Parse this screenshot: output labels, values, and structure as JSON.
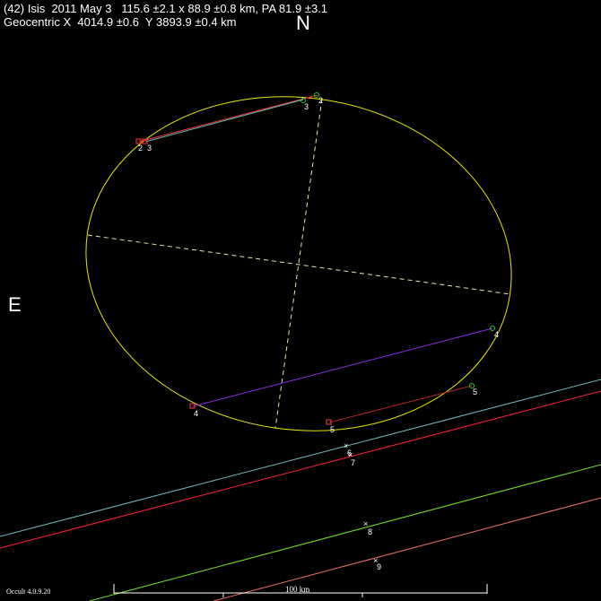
{
  "header": {
    "line1": "(42) Isis  2011 May 3   115.6 ±2.1 x 88.9 ±0.8 km, PA 81.9 ±3.1",
    "line2": "Geocentric X  4014.9 ±0.6  Y 3893.9 ±0.4 km"
  },
  "compass": {
    "north": "N",
    "east": "E"
  },
  "footer": {
    "version": "Occult 4.0.9.20",
    "scale_label": "100 km"
  },
  "colors": {
    "ellipse": "#e8e800",
    "axes": "#e8e8a0",
    "chord2_3_red": "#ff3030",
    "chord2_3_cyan": "#60c0c0",
    "chord4": "#8a2be2",
    "chord5": "#c02020",
    "miss6": "#70b8c0",
    "miss7": "#ff2030",
    "miss8": "#70e020",
    "miss9": "#f07060",
    "disappear_marker": "#ff4040",
    "reappear_marker": "#20d020"
  },
  "chord_labels": {
    "c2a": "2",
    "c3a": "3",
    "c3b": "3",
    "c2b": "2",
    "c4a": "4",
    "c4b": "4",
    "c5a": "5",
    "c5b": "5",
    "m6": "6",
    "m7": "7",
    "m8": "8",
    "m9": "9"
  }
}
